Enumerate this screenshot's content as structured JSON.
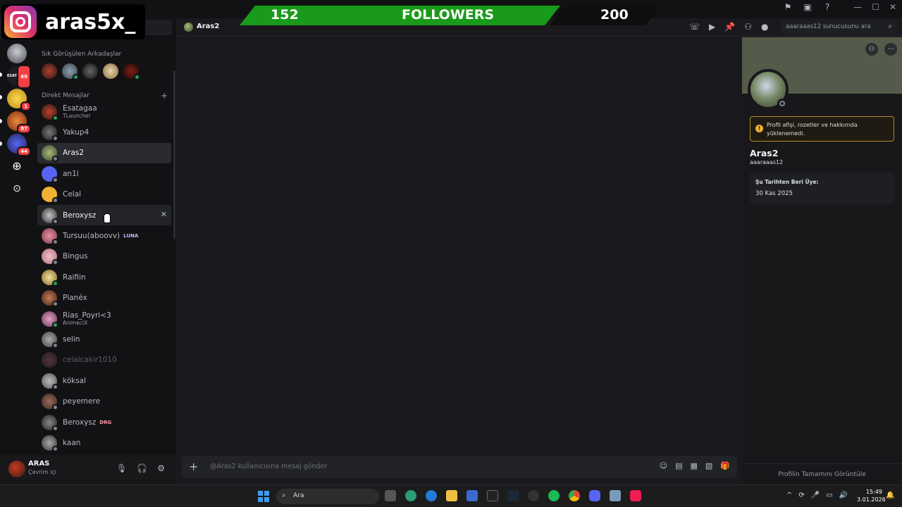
{
  "overlay": {
    "instagram_handle": "aras5x_",
    "followers_current": "152",
    "followers_label": "FOLLOWERS",
    "followers_goal": "200"
  },
  "colors": {
    "accent_green": "#1a9a1a",
    "online": "#23a55a",
    "offline": "#80848e",
    "badge_red": "#f23f43",
    "warning": "#f0b232"
  },
  "rail": {
    "badges": [
      "69",
      "1",
      "87",
      "44"
    ],
    "server_label": "ESATAGAA"
  },
  "sidebar": {
    "frequent_title": "Sık Görüşülen Arkadaşlar",
    "dm_title": "Direkt Mesajlar",
    "dms": [
      {
        "name": "Esatagaa",
        "sub": "TLauncher",
        "online": true
      },
      {
        "name": "Yakup4",
        "sub": "",
        "online": false
      },
      {
        "name": "Aras2",
        "sub": "",
        "online": false
      },
      {
        "name": "an1l",
        "sub": "",
        "online": false
      },
      {
        "name": "Celal",
        "sub": "",
        "online": false
      },
      {
        "name": "Beroxysz",
        "sub": "",
        "online": false
      },
      {
        "name": "Tursuu(aboovv)",
        "sub": "",
        "online": false,
        "tag": "LUNA"
      },
      {
        "name": "Bingus",
        "sub": "",
        "online": false
      },
      {
        "name": "Raifiin",
        "sub": "",
        "online": true
      },
      {
        "name": "Planéx",
        "sub": "",
        "online": false
      },
      {
        "name": "Rias_Poyri<3",
        "sub": "AnimeciX",
        "online": true
      },
      {
        "name": "selin",
        "sub": "",
        "online": false
      },
      {
        "name": "celalcakir1010",
        "sub": "",
        "online": false
      },
      {
        "name": "köksal",
        "sub": "",
        "online": false
      },
      {
        "name": "peyemere",
        "sub": "",
        "online": false
      },
      {
        "name": "Beroxysz",
        "sub": "",
        "online": false,
        "tag": "DRG"
      },
      {
        "name": "kaan",
        "sub": "",
        "online": false
      }
    ]
  },
  "user": {
    "name": "ARAS",
    "status": "Çevrim içi"
  },
  "chat": {
    "title": "Aras2",
    "search_placeholder": "aaaraaas12 sunucusunu ara",
    "composer_placeholder": "@Aras2 kullanıcısına mesaj gönder"
  },
  "profile": {
    "warning": "Profil afişi, rozetler ve hakkımda yüklenemedi.",
    "display_name": "Aras2",
    "username": "aaaraaas12",
    "member_since_title": "Şu Tarihten Beri Üye:",
    "member_since_value": "30 Kas 2025",
    "footer": "Profilin Tamamını Görüntüle"
  },
  "taskbar": {
    "search_text": "Ara",
    "time": "15:49",
    "date": "3.01.2026"
  }
}
